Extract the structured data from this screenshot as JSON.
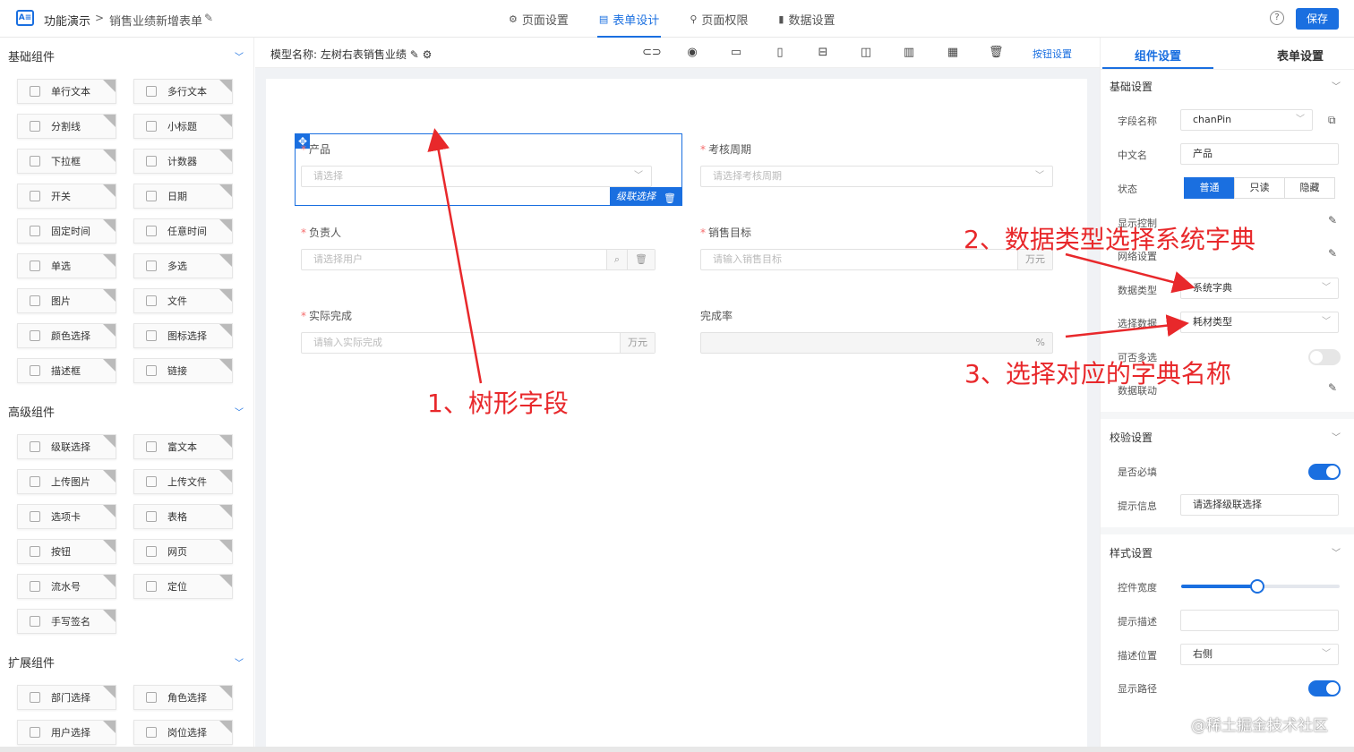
{
  "header": {
    "crumb1": "功能演示",
    "sep": ">",
    "crumb2": "销售业绩新增表单",
    "tabs": [
      {
        "label": "页面设置",
        "icon": "gear-icon"
      },
      {
        "label": "表单设计",
        "icon": "doc-icon"
      },
      {
        "label": "页面权限",
        "icon": "lock-icon"
      },
      {
        "label": "数据设置",
        "icon": "bar-chart-icon"
      }
    ],
    "save": "保存",
    "accent": "#1a6fe0"
  },
  "left": {
    "basic_title": "基础组件",
    "advanced_title": "高级组件",
    "ext_title": "扩展组件",
    "basic": [
      "单行文本",
      "多行文本",
      "分割线",
      "小标题",
      "下拉框",
      "计数器",
      "开关",
      "日期",
      "固定时间",
      "任意时间",
      "单选",
      "多选",
      "图片",
      "文件",
      "颜色选择",
      "图标选择",
      "描述框",
      "链接"
    ],
    "advanced": [
      "级联选择",
      "富文本",
      "上传图片",
      "上传文件",
      "选项卡",
      "表格",
      "按钮",
      "网页",
      "流水号",
      "定位",
      "手写签名"
    ],
    "ext": [
      "部门选择",
      "角色选择",
      "用户选择",
      "岗位选择"
    ]
  },
  "center": {
    "model_label": "模型名称: 左树右表销售业绩",
    "btn_settings": "按钮设置",
    "fields": {
      "product": {
        "label": "产品",
        "placeholder": "请选择"
      },
      "period": {
        "label": "考核周期",
        "placeholder": "请选择考核周期"
      },
      "owner": {
        "label": "负责人",
        "placeholder": "请选择用户"
      },
      "target": {
        "label": "销售目标",
        "placeholder": "请输入销售目标",
        "suffix": "万元"
      },
      "actual": {
        "label": "实际完成",
        "placeholder": "请输入实际完成",
        "suffix": "万元"
      },
      "rate": {
        "label": "完成率",
        "suffix": "%"
      }
    },
    "cascade_tag": "级联选择",
    "annotations": {
      "a1": "1、树形字段",
      "a2": "2、数据类型选择系统字典",
      "a3": "3、选择对应的字典名称"
    }
  },
  "right": {
    "tab_comp": "组件设置",
    "tab_form": "表单设置",
    "basic_title": "基础设置",
    "field_name_label": "字段名称",
    "field_name": "chanPin",
    "cn_label": "中文名",
    "cn_value": "产品",
    "state_label": "状态",
    "states": [
      "普通",
      "只读",
      "隐藏"
    ],
    "display_ctrl": "显示控制",
    "grid": "网络设置",
    "data_type_label": "数据类型",
    "data_type": "系统字典",
    "select_data_label": "选择数据",
    "select_data": "耗材类型",
    "multi_label": "可否多选",
    "linkage_label": "数据联动",
    "validate_title": "校验设置",
    "required_label": "是否必填",
    "tip_label": "提示信息",
    "tip_value": "请选择级联选择",
    "style_title": "样式设置",
    "width_label": "控件宽度",
    "width_value": 0.48,
    "desc_label": "提示描述",
    "desc_pos_label": "描述位置",
    "desc_pos": "右侧",
    "show_path": "显示路径"
  },
  "watermark": "@稀土掘金技术社区"
}
